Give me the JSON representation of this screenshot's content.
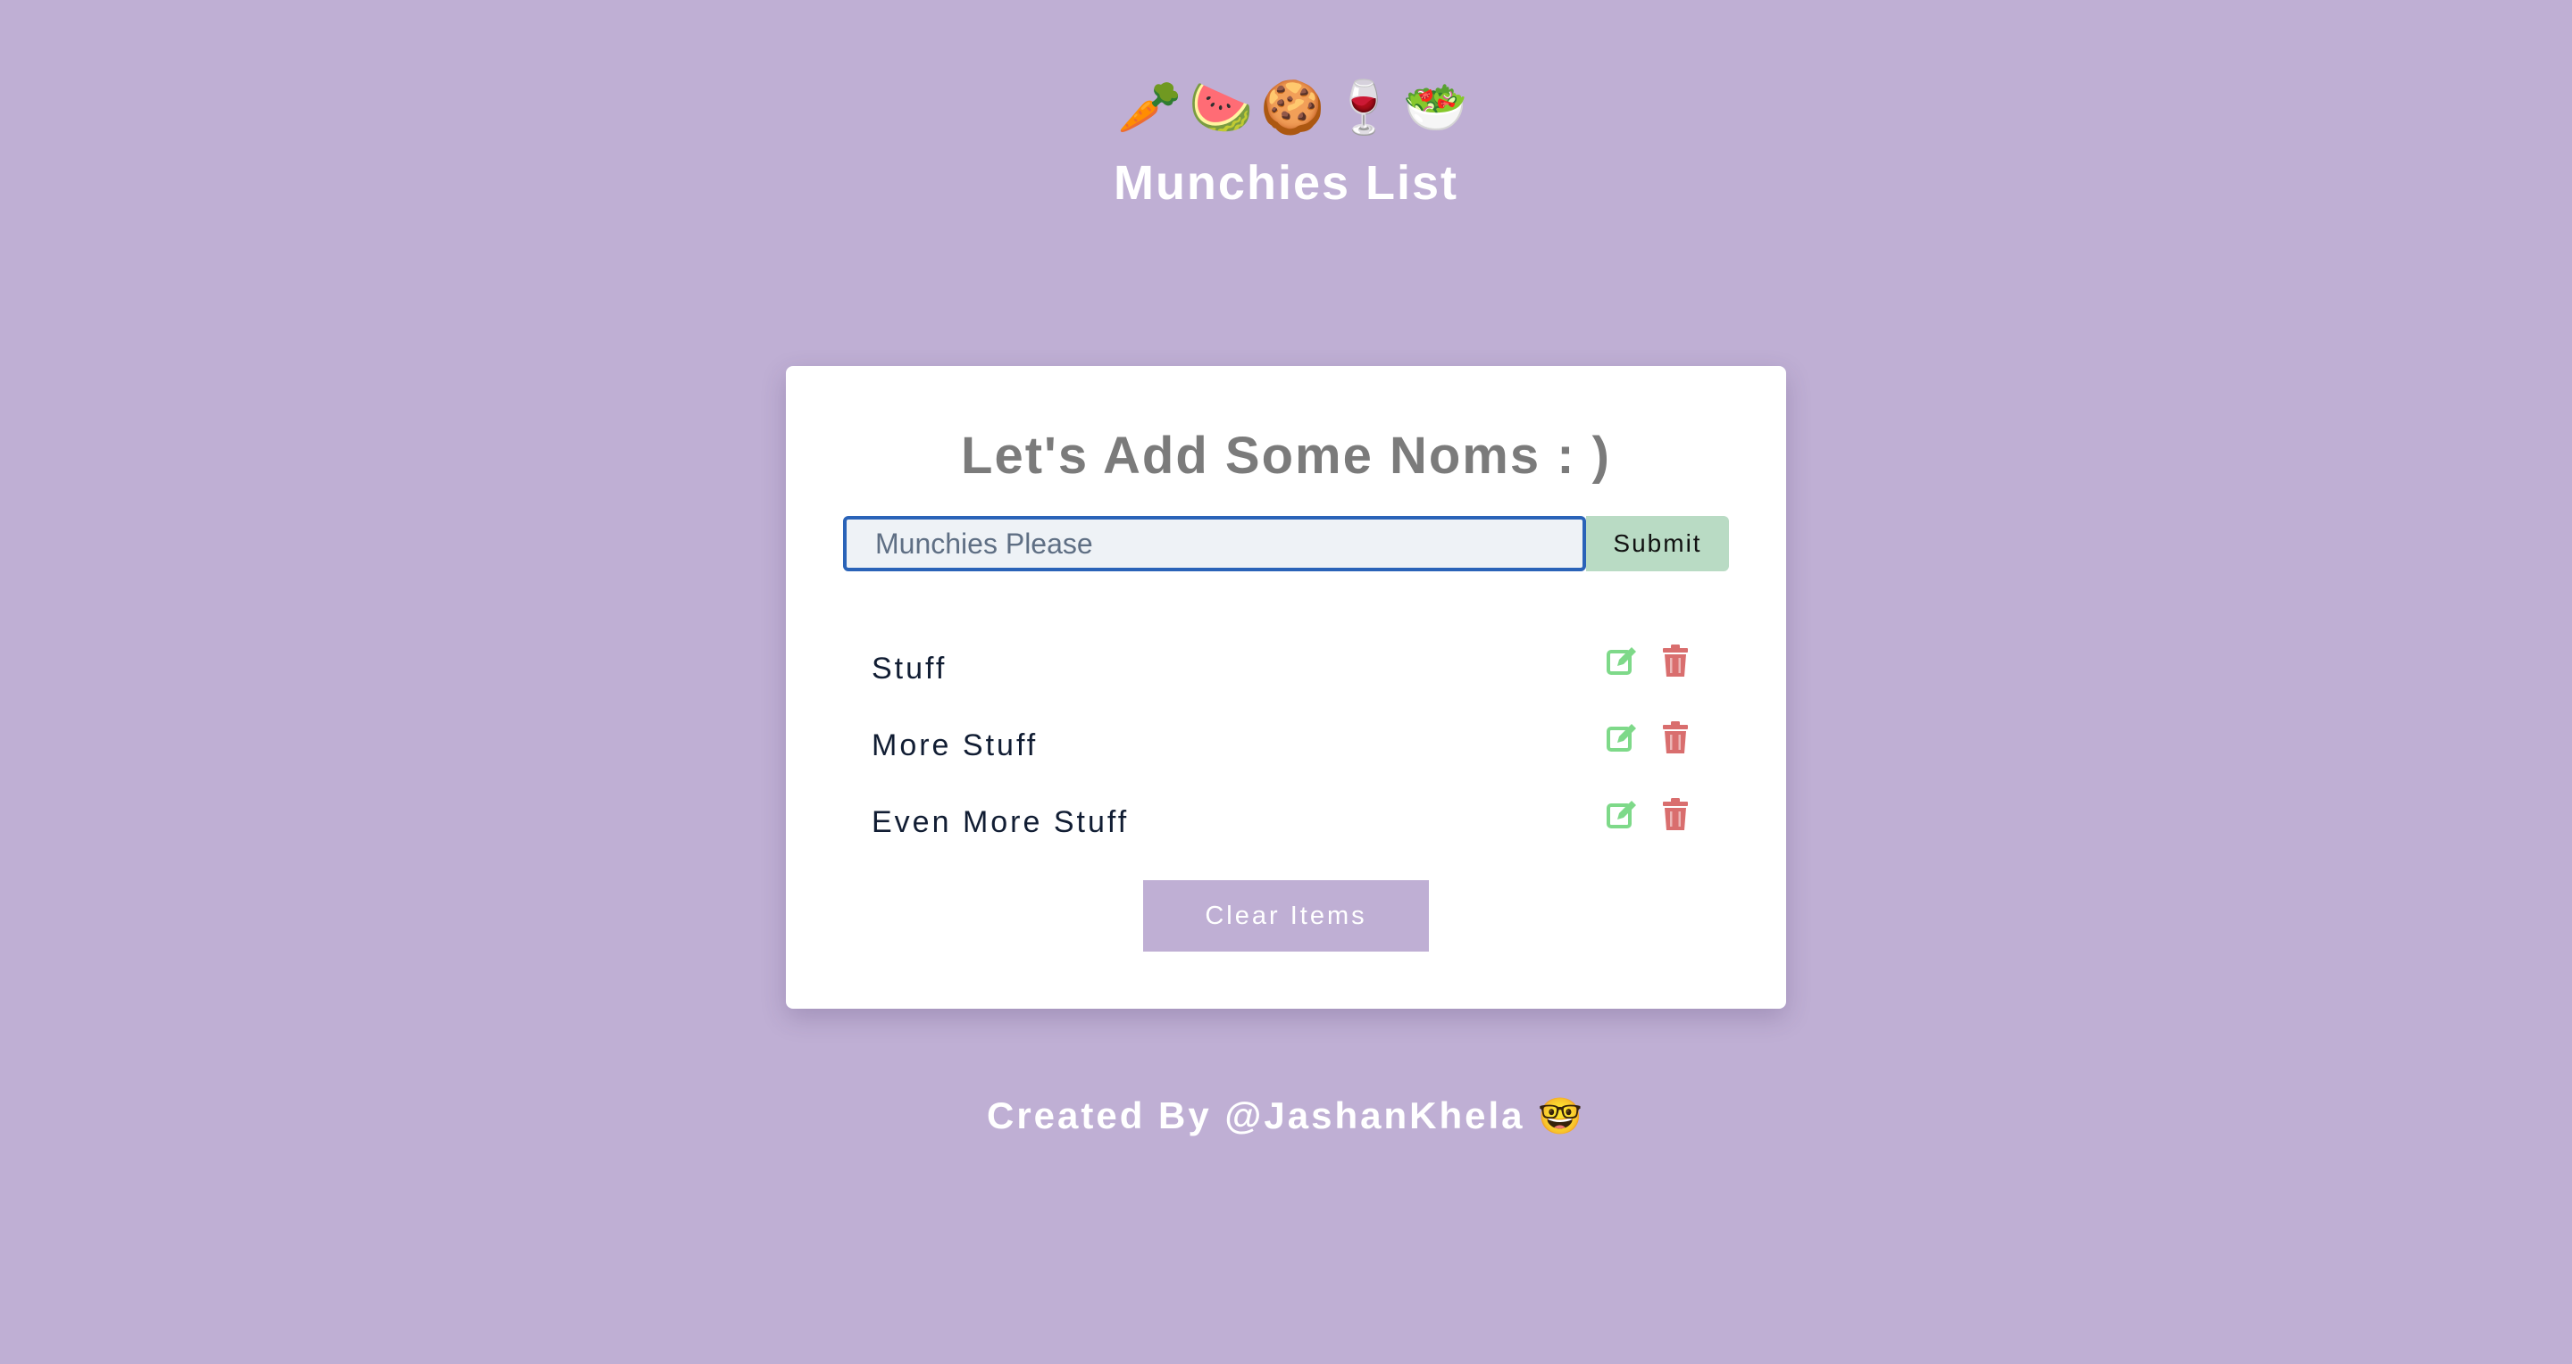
{
  "header": {
    "emojis": [
      "🥕",
      "🍉",
      "🍪",
      "🍷",
      "🥗"
    ],
    "title": "Munchies List"
  },
  "card": {
    "title": "Let's Add Some Noms : )",
    "input": {
      "placeholder": "Munchies Please",
      "value": ""
    },
    "submit_label": "Submit",
    "items": [
      {
        "label": "Stuff"
      },
      {
        "label": "More Stuff"
      },
      {
        "label": "Even More Stuff"
      }
    ],
    "clear_label": "Clear Items"
  },
  "footer": {
    "text": "Created By @JashanKhela",
    "emoji": "🤓"
  },
  "colors": {
    "background": "#bfafd4",
    "card": "#ffffff",
    "submit": "#b9dbc4",
    "edit_icon": "#7ed989",
    "delete_icon": "#d96e6e",
    "input_border": "#2a63b8",
    "title_gray": "#7b7b7b"
  },
  "icons": {
    "edit": "edit-icon",
    "delete": "trash-icon"
  }
}
